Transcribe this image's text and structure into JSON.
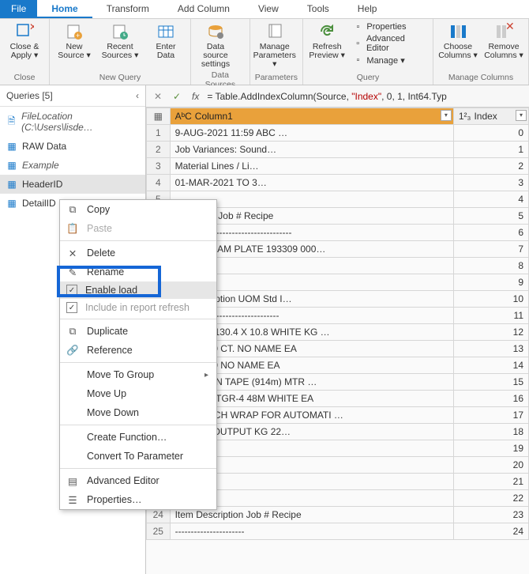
{
  "menubar": {
    "file": "File",
    "tabs": [
      "Home",
      "Transform",
      "Add Column",
      "View",
      "Tools",
      "Help"
    ],
    "active": 0
  },
  "ribbon": {
    "groups": [
      {
        "label": "Close",
        "buttons": [
          {
            "name": "close-apply",
            "label": "Close &\nApply ▾"
          }
        ]
      },
      {
        "label": "New Query",
        "buttons": [
          {
            "name": "new-source",
            "label": "New\nSource ▾"
          },
          {
            "name": "recent-sources",
            "label": "Recent\nSources ▾"
          },
          {
            "name": "enter-data",
            "label": "Enter\nData"
          }
        ]
      },
      {
        "label": "Data Sources",
        "buttons": [
          {
            "name": "data-source-settings",
            "label": "Data source\nsettings"
          }
        ]
      },
      {
        "label": "Parameters",
        "buttons": [
          {
            "name": "manage-parameters",
            "label": "Manage\nParameters ▾"
          }
        ]
      },
      {
        "label": "Query",
        "buttons": [
          {
            "name": "refresh-preview",
            "label": "Refresh\nPreview ▾"
          }
        ],
        "stack": [
          {
            "name": "properties",
            "label": "Properties"
          },
          {
            "name": "advanced-editor",
            "label": "Advanced Editor"
          },
          {
            "name": "manage",
            "label": "Manage ▾"
          }
        ]
      },
      {
        "label": "Manage Columns",
        "buttons": [
          {
            "name": "choose-columns",
            "label": "Choose\nColumns ▾"
          },
          {
            "name": "remove-columns",
            "label": "Remove\nColumns ▾"
          }
        ]
      }
    ]
  },
  "queries": {
    "title": "Queries [5]",
    "items": [
      {
        "name": "file-location",
        "label": "FileLocation (C:\\Users\\lisde…",
        "italic": true
      },
      {
        "name": "raw-data",
        "label": "RAW Data"
      },
      {
        "name": "example",
        "label": "Example",
        "italic": true
      },
      {
        "name": "header-id",
        "label": "HeaderID",
        "selected": true
      },
      {
        "name": "detail-id",
        "label": "DetailID"
      }
    ]
  },
  "formula": {
    "prefix": "= Table.AddIndexColumn(Source, ",
    "string": "\"Index\"",
    "suffix": ", 0, 1, Int64.Typ"
  },
  "columns": {
    "col1": "Column1",
    "col2": "Index",
    "col1type": "AᵇC",
    "col2type": "1²₃"
  },
  "rows": [
    {
      "n": 1,
      "c1": "9-AUG-2021 11:59                                        ABC …",
      "c2": "0"
    },
    {
      "n": 2,
      "c1": "Job Variances: Sound…",
      "c2": "1"
    },
    {
      "n": 3,
      "c1": "Material Lines / Li…",
      "c2": "2"
    },
    {
      "n": 4,
      "c1": "01-MAR-2021 TO 3…",
      "c2": "3"
    },
    {
      "n": 5,
      "c1": "",
      "c2": "4"
    },
    {
      "n": 6,
      "c1": "escription      Job #  Recipe",
      "c2": "5"
    },
    {
      "n": 7,
      "c1": "-------------------------------------",
      "c2": "6"
    },
    {
      "n": 8,
      "c1": "\" GEN FOAM PLATE       193309 000…",
      "c2": "7"
    },
    {
      "n": 9,
      "c1": "",
      "c2": "8"
    },
    {
      "n": 10,
      "c1": "Job",
      "c2": "9"
    },
    {
      "n": 11,
      "c1": "de   Description          UOM    Std I…",
      "c2": "10"
    },
    {
      "n": 12,
      "c1": "---------------------------------",
      "c2": "11"
    },
    {
      "n": 13,
      "c1": "0108WH  130.4 X 10.8     WHITE KG  …",
      "c2": "12"
    },
    {
      "n": 14,
      "c1": "1     9\" 12/50 CT. NO NAME     EA",
      "c2": "13"
    },
    {
      "n": 15,
      "c1": "1     9\" 12/50 NO NAME         EA",
      "c2": "14"
    },
    {
      "n": 16,
      "c1": "6     CARTON TAPE (914m)     MTR …",
      "c2": "15"
    },
    {
      "n": 17,
      "c1": "4     JNRP - TGR-4 48M WHITE   EA",
      "c2": "16"
    },
    {
      "n": 18,
      "c1": "0     STRETCH WRAP FOR AUTOMATI …",
      "c2": "17"
    },
    {
      "n": 19,
      "c1": "FLUFF - OUTPUT          KG      22…",
      "c2": "18"
    },
    {
      "n": 20,
      "c1": "",
      "c2": "19"
    },
    {
      "n": 21,
      "c1": "",
      "c2": "20"
    },
    {
      "n": 22,
      "c1": "",
      "c2": "21"
    },
    {
      "n": 23,
      "c1": "",
      "c2": "22"
    },
    {
      "n": 24,
      "c1": "Item    Description       Job #  Recipe",
      "c2": "23"
    },
    {
      "n": 25,
      "c1": "----------------------",
      "c2": "24"
    }
  ],
  "contextmenu": [
    {
      "type": "item",
      "icon": "copy",
      "label": "Copy"
    },
    {
      "type": "item",
      "icon": "paste",
      "label": "Paste",
      "disabled": true
    },
    {
      "type": "sep"
    },
    {
      "type": "item",
      "icon": "delete",
      "label": "Delete"
    },
    {
      "type": "item",
      "icon": "rename",
      "label": "Rename"
    },
    {
      "type": "check",
      "checked": true,
      "label": "Enable load",
      "highlight": true
    },
    {
      "type": "check",
      "checked": true,
      "label": "Include in report refresh",
      "faded": true
    },
    {
      "type": "sep"
    },
    {
      "type": "item",
      "icon": "duplicate",
      "label": "Duplicate"
    },
    {
      "type": "item",
      "icon": "reference",
      "label": "Reference"
    },
    {
      "type": "sep"
    },
    {
      "type": "item",
      "label": "Move To Group",
      "submenu": true
    },
    {
      "type": "item",
      "label": "Move Up"
    },
    {
      "type": "item",
      "label": "Move Down"
    },
    {
      "type": "sep"
    },
    {
      "type": "item",
      "label": "Create Function…"
    },
    {
      "type": "item",
      "label": "Convert To Parameter"
    },
    {
      "type": "sep"
    },
    {
      "type": "item",
      "icon": "adv",
      "label": "Advanced Editor"
    },
    {
      "type": "item",
      "icon": "props",
      "label": "Properties…"
    }
  ]
}
